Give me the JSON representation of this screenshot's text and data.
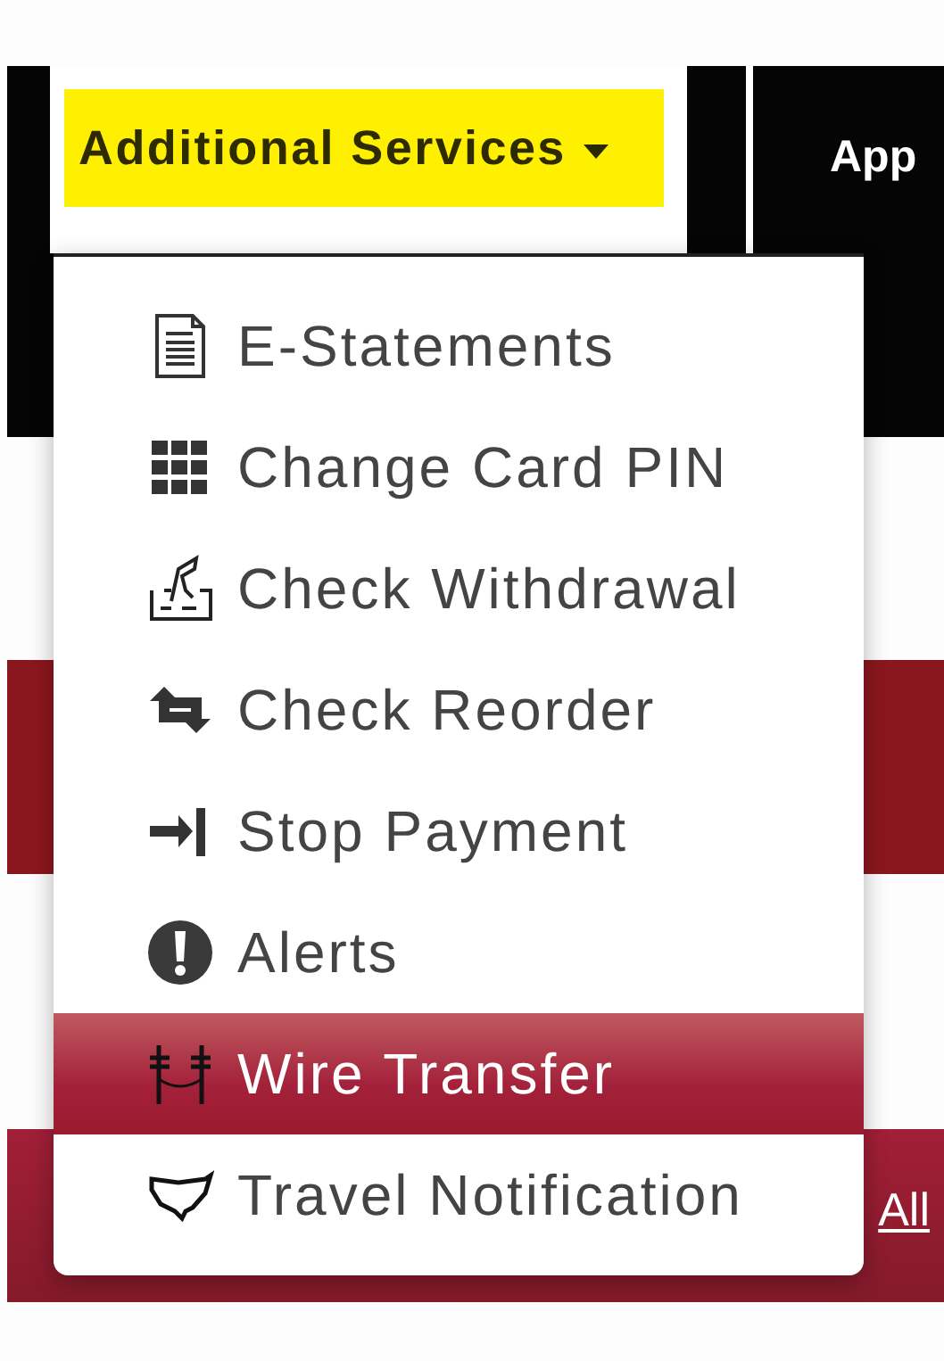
{
  "nav": {
    "tabs": [
      {
        "label": "Additional Services",
        "expanded": true
      },
      {
        "label": "App"
      }
    ]
  },
  "menu": {
    "items": [
      {
        "label": "E-Statements",
        "selected": false
      },
      {
        "label": "Change Card PIN",
        "selected": false
      },
      {
        "label": "Check Withdrawal",
        "selected": false
      },
      {
        "label": "Check Reorder",
        "selected": false
      },
      {
        "label": "Stop Payment",
        "selected": false
      },
      {
        "label": "Alerts",
        "selected": false
      },
      {
        "label": "Wire Transfer",
        "selected": true
      },
      {
        "label": "Travel Notification",
        "selected": false
      }
    ]
  },
  "band_link": "All"
}
